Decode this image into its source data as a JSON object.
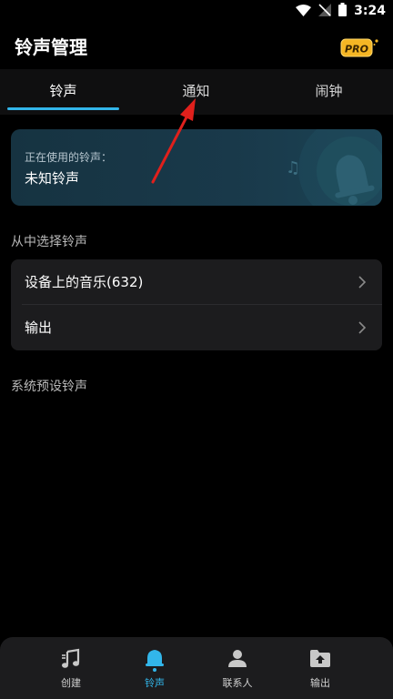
{
  "status_bar": {
    "time": "3:24"
  },
  "header": {
    "title": "铃声管理",
    "pro_badge": "PRO"
  },
  "tabs": [
    {
      "label": "铃声",
      "active": true
    },
    {
      "label": "通知",
      "active": false
    },
    {
      "label": "闹钟",
      "active": false
    }
  ],
  "current_ringtone": {
    "label": "正在使用的铃声：",
    "value": "未知铃声"
  },
  "select_section": {
    "title": "从中选择铃声"
  },
  "sources": [
    {
      "label": "设备上的音乐(632)"
    },
    {
      "label": "输出"
    }
  ],
  "preset_section": {
    "title": "系统预设铃声"
  },
  "bottom_nav": [
    {
      "label": "创建",
      "icon": "music-note-icon",
      "active": false
    },
    {
      "label": "铃声",
      "icon": "bell-icon",
      "active": true
    },
    {
      "label": "联系人",
      "icon": "person-icon",
      "active": false
    },
    {
      "label": "输出",
      "icon": "folder-upload-icon",
      "active": false
    }
  ],
  "colors": {
    "accent": "#32b6ea",
    "pro_badge": "#f5b624",
    "annotation_arrow": "#e0201c"
  }
}
